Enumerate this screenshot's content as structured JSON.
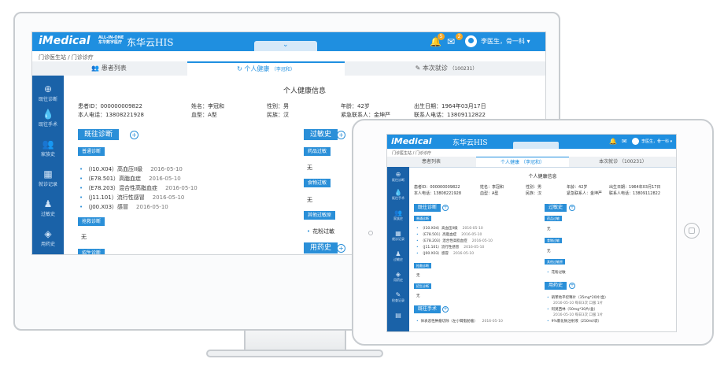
{
  "app": {
    "logo": "iMedical",
    "logo_sub_line1": "ALL-IN-ONE",
    "logo_sub_line2": "东华数字医疗",
    "logo_cn": "东华云HIS",
    "center_chevron": "⌄",
    "notification_count": "5",
    "message_count": "2",
    "user_name": "李医生，骨一科 ▾"
  },
  "breadcrumb": "门诊医生站 / 门诊诊疗",
  "tabs": [
    {
      "label": "患者列表"
    },
    {
      "label": "个人健康",
      "sub": "（李冠和）"
    },
    {
      "label": "本次就诊",
      "sub": "（100231）"
    }
  ],
  "sidebar": {
    "items": [
      {
        "icon": "⊕",
        "label": "既往诊断"
      },
      {
        "icon": "💧",
        "label": "既往手术"
      },
      {
        "icon": "👥",
        "label": "家族史"
      },
      {
        "icon": "▦",
        "label": "就诊记录"
      },
      {
        "icon": "♟",
        "label": "过敏史"
      },
      {
        "icon": "◈",
        "label": "用药史"
      }
    ]
  },
  "tablet_sidebar_extra": [
    {
      "icon": "✎",
      "label": "检查记录"
    },
    {
      "icon": "▤",
      "label": ""
    }
  ],
  "page_title": "个人健康信息",
  "patient": {
    "id_label": "患者ID：",
    "id": "000000009822",
    "name_label": "姓名：",
    "name": "李冠和",
    "gender_label": "性别：",
    "gender": "男",
    "age_label": "年龄：",
    "age": "42岁",
    "birth_label": "出生日期：",
    "birth": "1964年03月17日",
    "phone_label": "本人电话：",
    "phone": "13808221928",
    "blood_label": "血型：",
    "blood": "A型",
    "ethnic_label": "民族：",
    "ethnic": "汉",
    "contact_label": "紧急联系人：",
    "contact": "金坤严",
    "contact_phone_label": "联系人电话：",
    "contact_phone": "13809112822"
  },
  "sections": {
    "past_diagnosis": "既往诊断",
    "normal_diagnosis": "普通诊断",
    "diagnoses": [
      {
        "code": "（I10.X04）",
        "name": "高血压II级",
        "date": "2016-05-10"
      },
      {
        "code": "（E78.501）",
        "name": "高脂血症",
        "date": "2016-05-10"
      },
      {
        "code": "（E78.203）",
        "name": "混合性高脂血症",
        "date": "2016-05-10"
      },
      {
        "code": "（J11.101）",
        "name": "流行性感冒",
        "date": "2016-05-10"
      },
      {
        "code": "（J00.X03）",
        "name": "感冒",
        "date": "2016-05-10"
      }
    ],
    "rescue_diagnosis": "抢救诊断",
    "none": "无",
    "discharge_diagnosis": "招生诊断",
    "allergy": "过敏史",
    "drug_allergy": "药品过敏",
    "food_allergy": "食物过敏",
    "other_allergy": "其他过敏原",
    "pollen": "花粉过敏",
    "medication": "用药史",
    "surgery": "既往手术",
    "surgery_item": "体表恶性肿瘤切除（左小臂脂肪瘤）",
    "surgery_date": "2016-05-10",
    "meds": [
      "硝苯地平控释片（35mg*20片/盒）",
      "阿莫西林（50mg*30片/盒）",
      "9%氯化钠注射液（250ml/袋）"
    ],
    "meds_dates": [
      "2016-05-10  每日3次  口服  1片",
      "2016-05-10  每日3次  口服  1片",
      ""
    ]
  },
  "colors": {
    "accent": "#1f8fe0",
    "sidebar": "#1a62a8",
    "badge": "#f5a623"
  }
}
